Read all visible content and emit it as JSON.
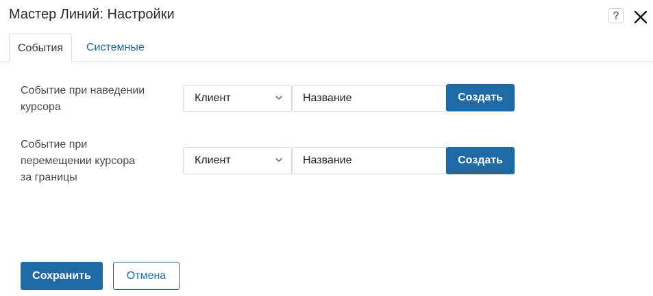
{
  "dialog": {
    "title": "Мастер Линий: Настройки",
    "help_label": "?"
  },
  "tabs": [
    {
      "label": "События",
      "active": true
    },
    {
      "label": "Системные",
      "active": false
    }
  ],
  "rows": [
    {
      "label_lines": [
        "Событие при наведении",
        "курсора"
      ],
      "select_value": "Клиент",
      "input_value": "Название",
      "button_label": "Создать"
    },
    {
      "label_lines": [
        "Событие при",
        "перемещении курсора",
        "за границы"
      ],
      "select_value": "Клиент",
      "input_value": "Название",
      "button_label": "Создать"
    }
  ],
  "footer": {
    "save_label": "Сохранить",
    "cancel_label": "Отмена"
  },
  "colors": {
    "accent": "#1f6aa5",
    "border": "#d9d9d9"
  },
  "icons": [
    "help-icon",
    "close-icon",
    "chevron-down-icon"
  ]
}
